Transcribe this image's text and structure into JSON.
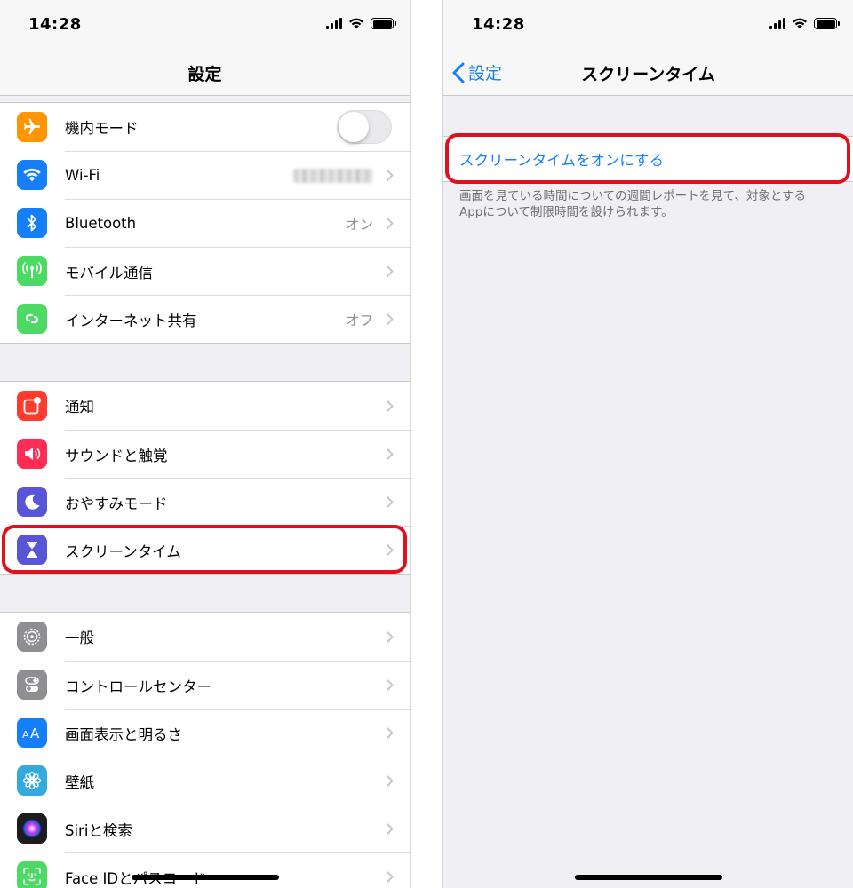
{
  "left": {
    "status_time": "14:28",
    "nav_title": "設定",
    "group1": [
      {
        "label": "機内モード",
        "icon": "airplane-icon",
        "color": "#ff9500",
        "accessory": "toggle",
        "toggle_on": false
      },
      {
        "label": "Wi-Fi",
        "icon": "wifi-icon",
        "color": "#147efb",
        "accessory": "blurred"
      },
      {
        "label": "Bluetooth",
        "icon": "bluetooth-icon",
        "color": "#147efb",
        "value": "オン"
      },
      {
        "label": "モバイル通信",
        "icon": "antenna-icon",
        "color": "#4cd964"
      },
      {
        "label": "インターネット共有",
        "icon": "hotspot-icon",
        "color": "#4cd964",
        "value": "オフ"
      }
    ],
    "group2": [
      {
        "label": "通知",
        "icon": "notifications-icon",
        "color": "#ff3b30"
      },
      {
        "label": "サウンドと触覚",
        "icon": "speaker-icon",
        "color": "#ff2d55"
      },
      {
        "label": "おやすみモード",
        "icon": "moon-icon",
        "color": "#5856d6"
      },
      {
        "label": "スクリーンタイム",
        "icon": "hourglass-icon",
        "color": "#5856d6"
      }
    ],
    "group3": [
      {
        "label": "一般",
        "icon": "gear-icon",
        "color": "#8e8e93"
      },
      {
        "label": "コントロールセンター",
        "icon": "switches-icon",
        "color": "#8e8e93"
      },
      {
        "label": "画面表示と明るさ",
        "icon": "text-size-icon",
        "color": "#147efb"
      },
      {
        "label": "壁紙",
        "icon": "flower-icon",
        "color": "#34aadc"
      },
      {
        "label": "Siriと検索",
        "icon": "siri-icon",
        "color": "#1c1c1e"
      },
      {
        "label": "Face IDとパスコード",
        "icon": "faceid-icon",
        "color": "#4cd964"
      }
    ]
  },
  "right": {
    "status_time": "14:28",
    "back_label": "設定",
    "nav_title": "スクリーンタイム",
    "action_label": "スクリーンタイムをオンにする",
    "footer_text": "画面を見ている時間についての週間レポートを見て、対象とするAppについて制限時間を設けられます。"
  },
  "colors": {
    "accent": "#147efb",
    "highlight": "#e0101e",
    "background": "#efeff4"
  }
}
